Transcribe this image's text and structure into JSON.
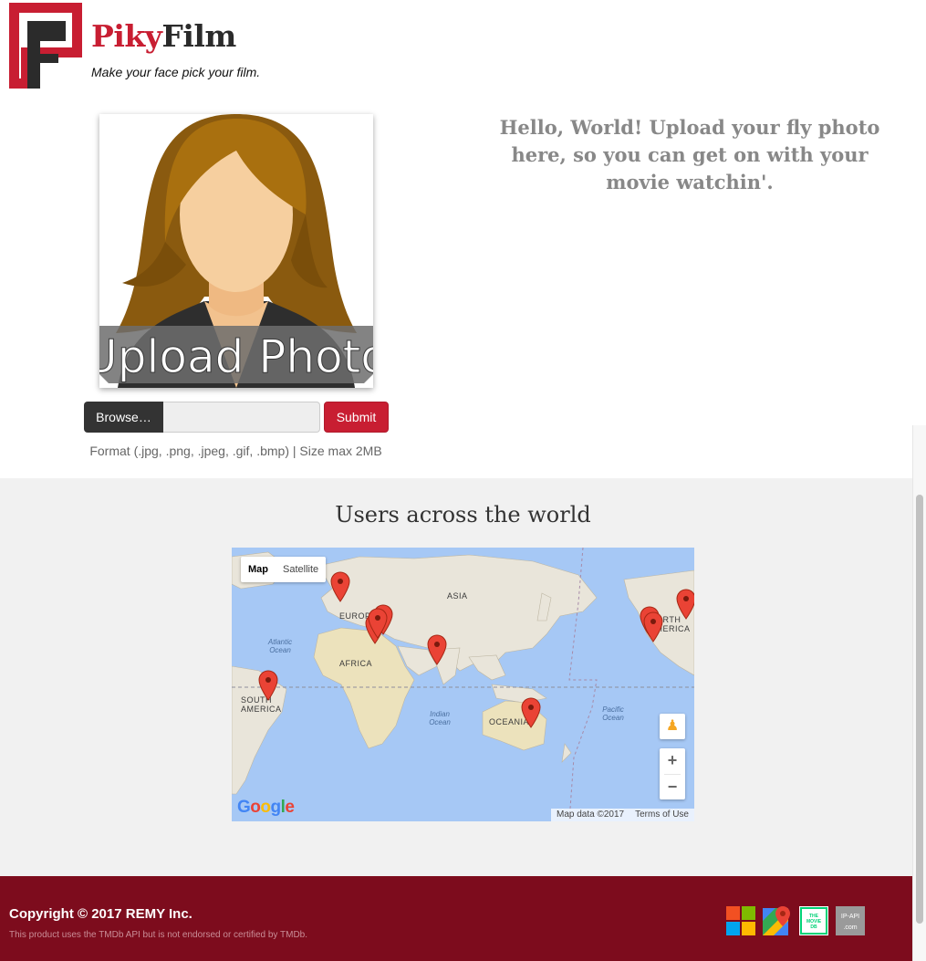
{
  "brand": {
    "name_part1": "Piky",
    "name_part2": "Film",
    "tagline": "Make your face pick your film.",
    "colors": {
      "red": "#c81e32",
      "dark": "#2b2b2b"
    }
  },
  "upload": {
    "image_text": "Upload Photo",
    "browse_label": "Browse…",
    "file_name": "",
    "submit_label": "Submit",
    "format_hint": "Format (.jpg, .png, .jpeg, .gif, .bmp) | Size max 2MB"
  },
  "hello_message": "Hello, World! Upload your fly photo here, so you can get on with your movie watchin'.",
  "world": {
    "title": "Users across the world",
    "map": {
      "type_buttons": [
        "Map",
        "Satellite"
      ],
      "active_type": "Map",
      "zoom_in": "+",
      "zoom_out": "−",
      "google_logo": "Google",
      "attribution": "Map data ©2017",
      "terms": "Terms of Use",
      "continent_labels": [
        "ASIA",
        "EUROPE",
        "AFRICA",
        "SOUTH AMERICA",
        "OCEANIA",
        "NORTH AMERICA"
      ],
      "ocean_labels": [
        "Atlantic Ocean",
        "Indian Ocean",
        "Pacific Ocean"
      ],
      "marker_count": 10,
      "marker_color": "#ea4335"
    }
  },
  "footer": {
    "copyright": "Copyright © 2017 REMY Inc.",
    "disclaimer": "This product uses the TMDb API but is not endorsed or certified by TMDb.",
    "partners": [
      {
        "name": "microsoft-logo"
      },
      {
        "name": "google-maps-logo"
      },
      {
        "name": "themoviedb-logo",
        "text": "THE MOVIE DB"
      },
      {
        "name": "ip-api-logo",
        "text_line1": "IP-API",
        "text_line2": ".com"
      }
    ],
    "background": "#7d0c1d"
  }
}
